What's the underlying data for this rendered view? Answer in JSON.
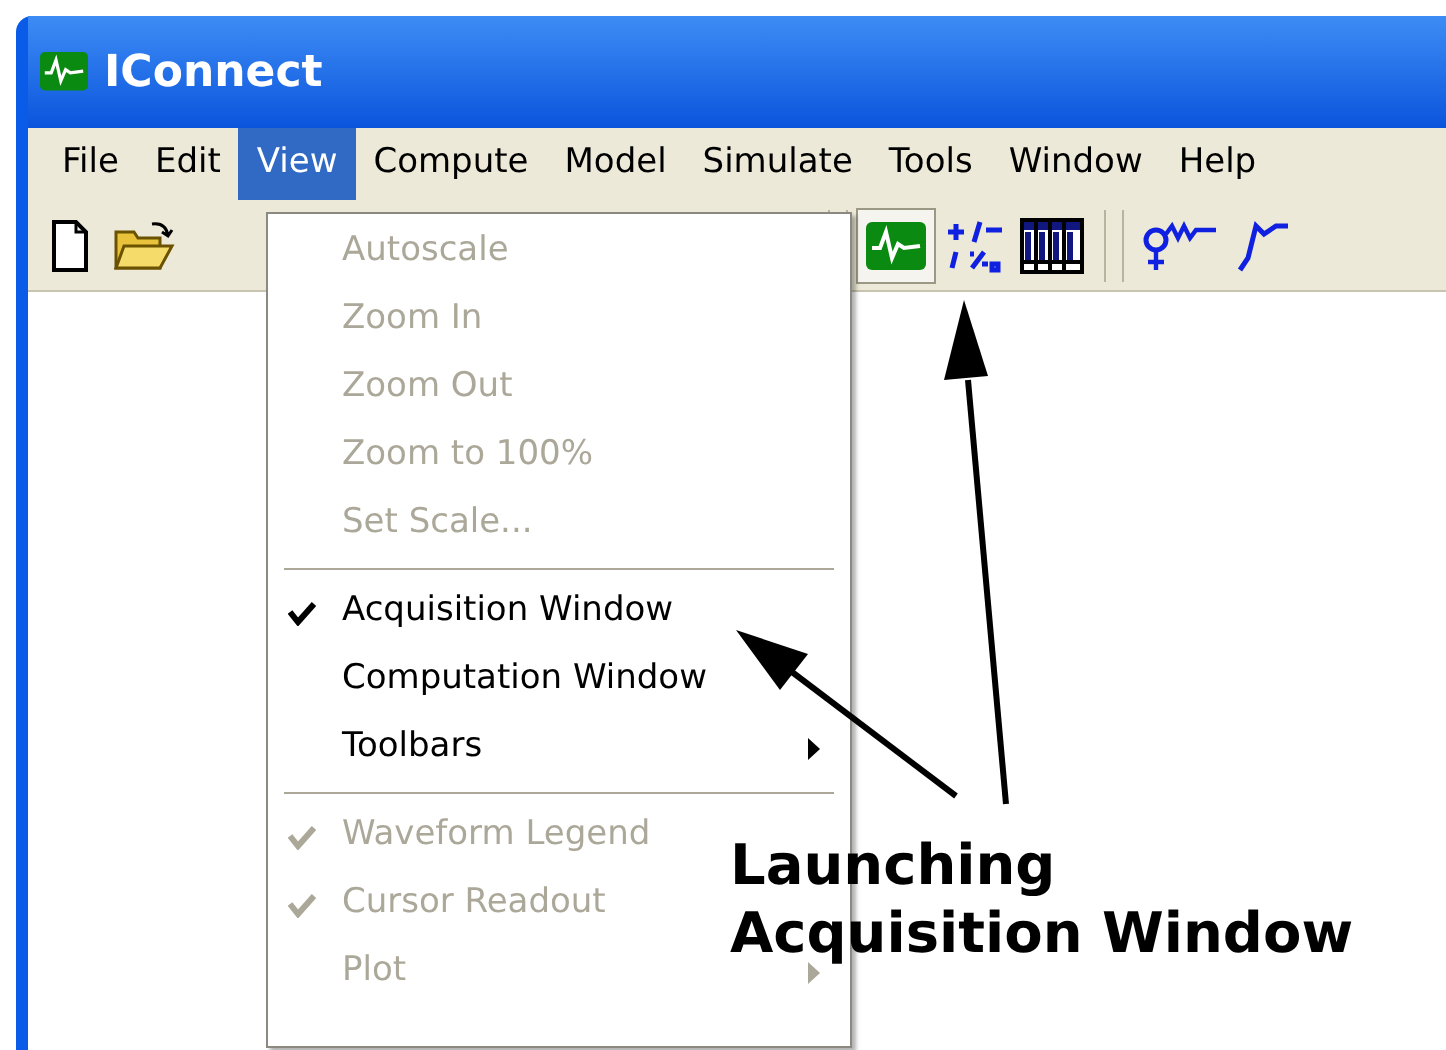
{
  "window": {
    "title": "IConnect"
  },
  "menu_bar": [
    {
      "label": "File",
      "selected": false
    },
    {
      "label": "Edit",
      "selected": false
    },
    {
      "label": "View",
      "selected": true
    },
    {
      "label": "Compute",
      "selected": false
    },
    {
      "label": "Model",
      "selected": false
    },
    {
      "label": "Simulate",
      "selected": false
    },
    {
      "label": "Tools",
      "selected": false
    },
    {
      "label": "Window",
      "selected": false
    },
    {
      "label": "Help",
      "selected": false
    }
  ],
  "toolbar": [
    {
      "kind": "new",
      "pressed": false
    },
    {
      "kind": "open",
      "pressed": false
    },
    {
      "kind": "grip"
    },
    {
      "kind": "acquisition",
      "pressed": true
    },
    {
      "kind": "compute",
      "pressed": false
    },
    {
      "kind": "table",
      "pressed": false
    },
    {
      "kind": "grip"
    },
    {
      "kind": "model",
      "pressed": false
    },
    {
      "kind": "curve",
      "pressed": false
    }
  ],
  "view_menu": [
    {
      "kind": "item",
      "label": "Autoscale",
      "checked": false,
      "disabled": true,
      "submenu": false
    },
    {
      "kind": "item",
      "label": "Zoom In",
      "checked": false,
      "disabled": true,
      "submenu": false
    },
    {
      "kind": "item",
      "label": "Zoom Out",
      "checked": false,
      "disabled": true,
      "submenu": false
    },
    {
      "kind": "item",
      "label": "Zoom to 100%",
      "checked": false,
      "disabled": true,
      "submenu": false
    },
    {
      "kind": "item",
      "label": "Set Scale...",
      "checked": false,
      "disabled": true,
      "submenu": false
    },
    {
      "kind": "separator"
    },
    {
      "kind": "item",
      "label": "Acquisition Window",
      "checked": true,
      "disabled": false,
      "submenu": false
    },
    {
      "kind": "item",
      "label": "Computation Window",
      "checked": false,
      "disabled": false,
      "submenu": false
    },
    {
      "kind": "item",
      "label": "Toolbars",
      "checked": false,
      "disabled": false,
      "submenu": true
    },
    {
      "kind": "separator"
    },
    {
      "kind": "item",
      "label": "Waveform Legend",
      "checked": true,
      "disabled": true,
      "submenu": false
    },
    {
      "kind": "item",
      "label": "Cursor Readout",
      "checked": true,
      "disabled": true,
      "submenu": false
    },
    {
      "kind": "item",
      "label": "Plot",
      "checked": false,
      "disabled": true,
      "submenu": true
    }
  ],
  "annotation": {
    "text": "Launching Acquisition Window"
  }
}
